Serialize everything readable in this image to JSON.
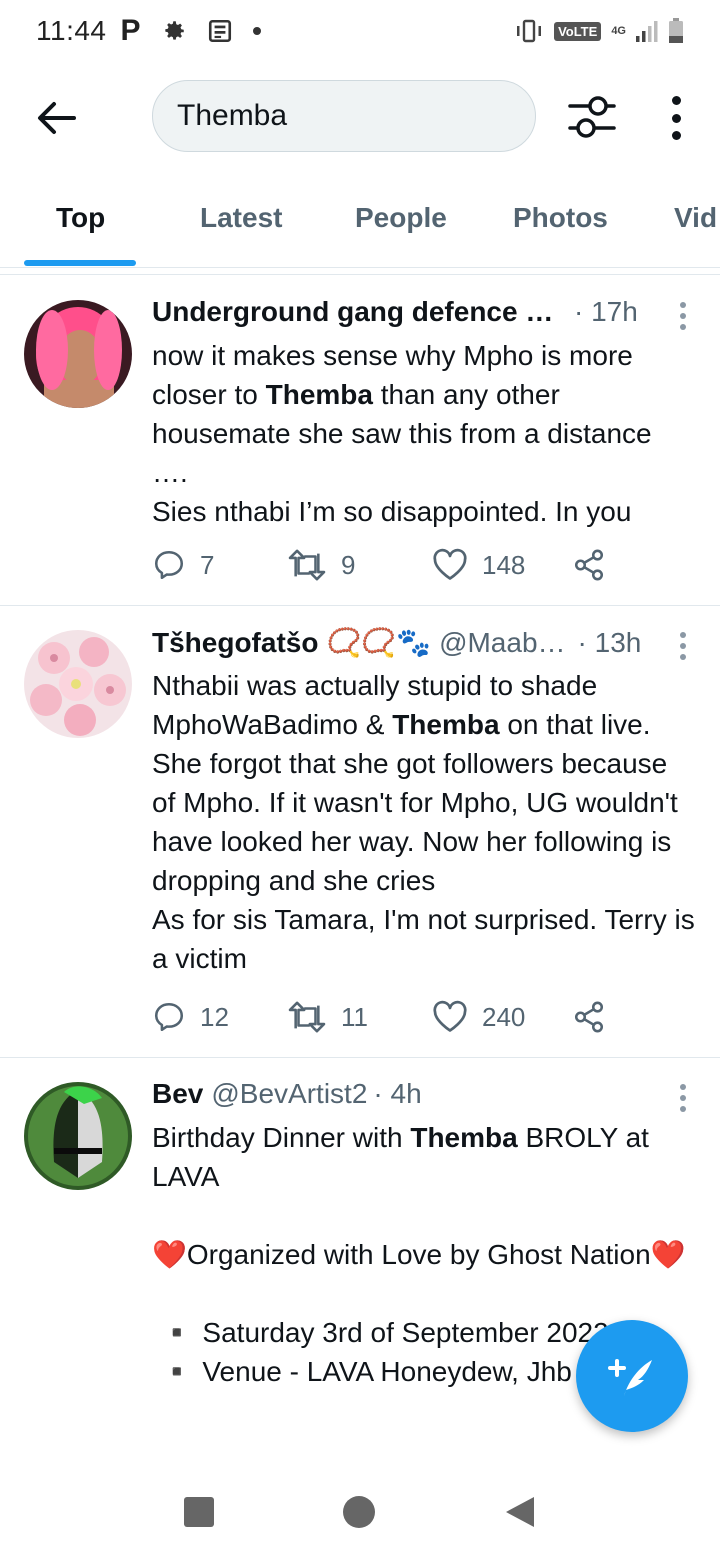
{
  "status_bar": {
    "time": "11:44",
    "p_badge": "P",
    "volte": "VoLTE",
    "network": "4G"
  },
  "search": {
    "query": "Themba",
    "back_icon": "arrow-left-icon",
    "filter_icon": "sliders-icon",
    "more_icon": "more-vertical-icon"
  },
  "tabs": [
    {
      "label": "Top",
      "active": true
    },
    {
      "label": "Latest",
      "active": false
    },
    {
      "label": "People",
      "active": false
    },
    {
      "label": "Photos",
      "active": false
    },
    {
      "label": "Vid",
      "active": false
    }
  ],
  "tweets": [
    {
      "name": "Underground gang defence f…",
      "handle": "",
      "time": "· 17h",
      "text_parts": [
        {
          "t": "now it makes sense why Mpho is more closer to "
        },
        {
          "t": "Themba",
          "bold": true
        },
        {
          "t": " than any other housemate she saw this from a distance\n….\nSies nthabi I’m so disappointed. In you"
        }
      ],
      "replies": "7",
      "retweets": "9",
      "likes": "148"
    },
    {
      "name": "Tšhegofatšo",
      "emoji": "📿📿🐾",
      "handle": "@Maab…",
      "time": "· 13h",
      "text_parts": [
        {
          "t": "Nthabii was actually stupid to shade MphoWaBadimo & "
        },
        {
          "t": "Themba",
          "bold": true
        },
        {
          "t": " on that live. She forgot that she got followers because of Mpho. If it wasn't for Mpho, UG wouldn't have looked her way. Now her following is dropping and she cries\nAs for sis Tamara, I'm not surprised. Terry is a victim"
        }
      ],
      "replies": "12",
      "retweets": "11",
      "likes": "240"
    },
    {
      "name": "Bev",
      "handle": "@BevArtist2",
      "time": "· 4h",
      "text_parts": [
        {
          "t": "Birthday Dinner with "
        },
        {
          "t": "Themba",
          "bold": true
        },
        {
          "t": " BROLY at LAVA\n\n❤️Organized with Love by Ghost Nation❤️\n\n ▪️ Saturday 3rd of September 2022\n ▪️ Venue - LAVA Honeydew, Jhb"
        }
      ]
    }
  ],
  "fab": {
    "icon": "compose-tweet-icon",
    "color": "#1d9bf0"
  },
  "accent": "#1d9bf0"
}
